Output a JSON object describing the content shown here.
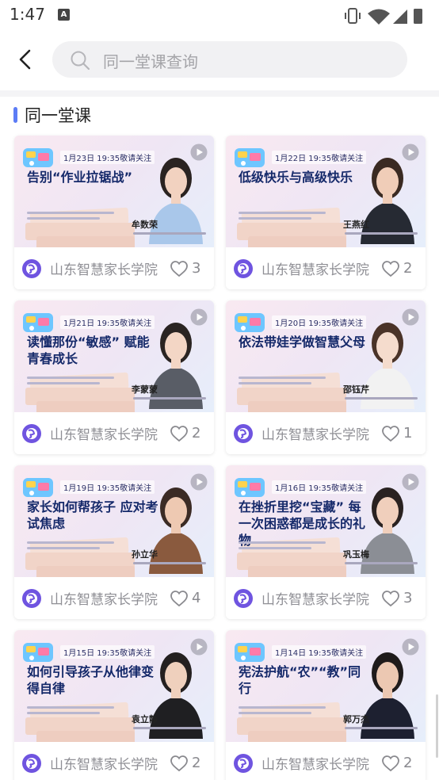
{
  "status_bar": {
    "time": "1:47",
    "notification_glyph": "A",
    "icons": [
      "vibrate-icon",
      "wifi-icon",
      "signal-icon",
      "battery-icon"
    ]
  },
  "header": {
    "back_icon": "back-chevron-icon",
    "search_placeholder": "同一堂课查询"
  },
  "section": {
    "title": "同一堂课",
    "accent_color": "#5c7cf6"
  },
  "cards": [
    {
      "date": "1月23日 19:35敬请关注",
      "headline": "告别“作业拉锯战”",
      "speaker": "牟数荣",
      "org": "山东智慧家长学院",
      "likes": "3",
      "photo_theme": "blue-dress"
    },
    {
      "date": "1月22日 19:35敬请关注",
      "headline": "低级快乐与高级快乐",
      "speaker": "王燕红",
      "org": "山东智慧家长学院",
      "likes": "2",
      "photo_theme": "dark-suit"
    },
    {
      "date": "1月21日 19:35敬请关注",
      "headline": "读懂那份“敏感” 赋能青春成长",
      "speaker": "李蒙蒙",
      "org": "山东智慧家长学院",
      "likes": "2",
      "photo_theme": "grey-coat"
    },
    {
      "date": "1月20日 19:35敬请关注",
      "headline": "依法带娃学做智慧父母",
      "speaker": "邵钰芹",
      "org": "山东智慧家长学院",
      "likes": "1",
      "photo_theme": "white-suit"
    },
    {
      "date": "1月19日 19:35敬请关注",
      "headline": "家长如何帮孩子 应对考试焦虑",
      "speaker": "孙立华",
      "org": "山东智慧家长学院",
      "likes": "4",
      "photo_theme": "patterned-sweater"
    },
    {
      "date": "1月16日 19:35敬请关注",
      "headline": "在挫折里挖“宝藏” 每一次困惑都是成长的礼物",
      "speaker": "巩玉梅",
      "org": "山东智慧家长学院",
      "likes": "3",
      "photo_theme": "grey-blazer"
    },
    {
      "date": "1月15日 19:35敬请关注",
      "headline": "如何引导孩子从他律变得自律",
      "speaker": "袁立静",
      "org": "山东智慧家长学院",
      "likes": "2",
      "photo_theme": "black-outfit"
    },
    {
      "date": "1月14日 19:35敬请关注",
      "headline": "宪法护航“农”“教”同行",
      "speaker": "郭万杰",
      "org": "山东智慧家长学院",
      "likes": "2",
      "photo_theme": "black-suit"
    }
  ],
  "colors": {
    "headline": "#15296a",
    "org_text": "#8f8f95",
    "logo_purple": "#6f54e0"
  }
}
